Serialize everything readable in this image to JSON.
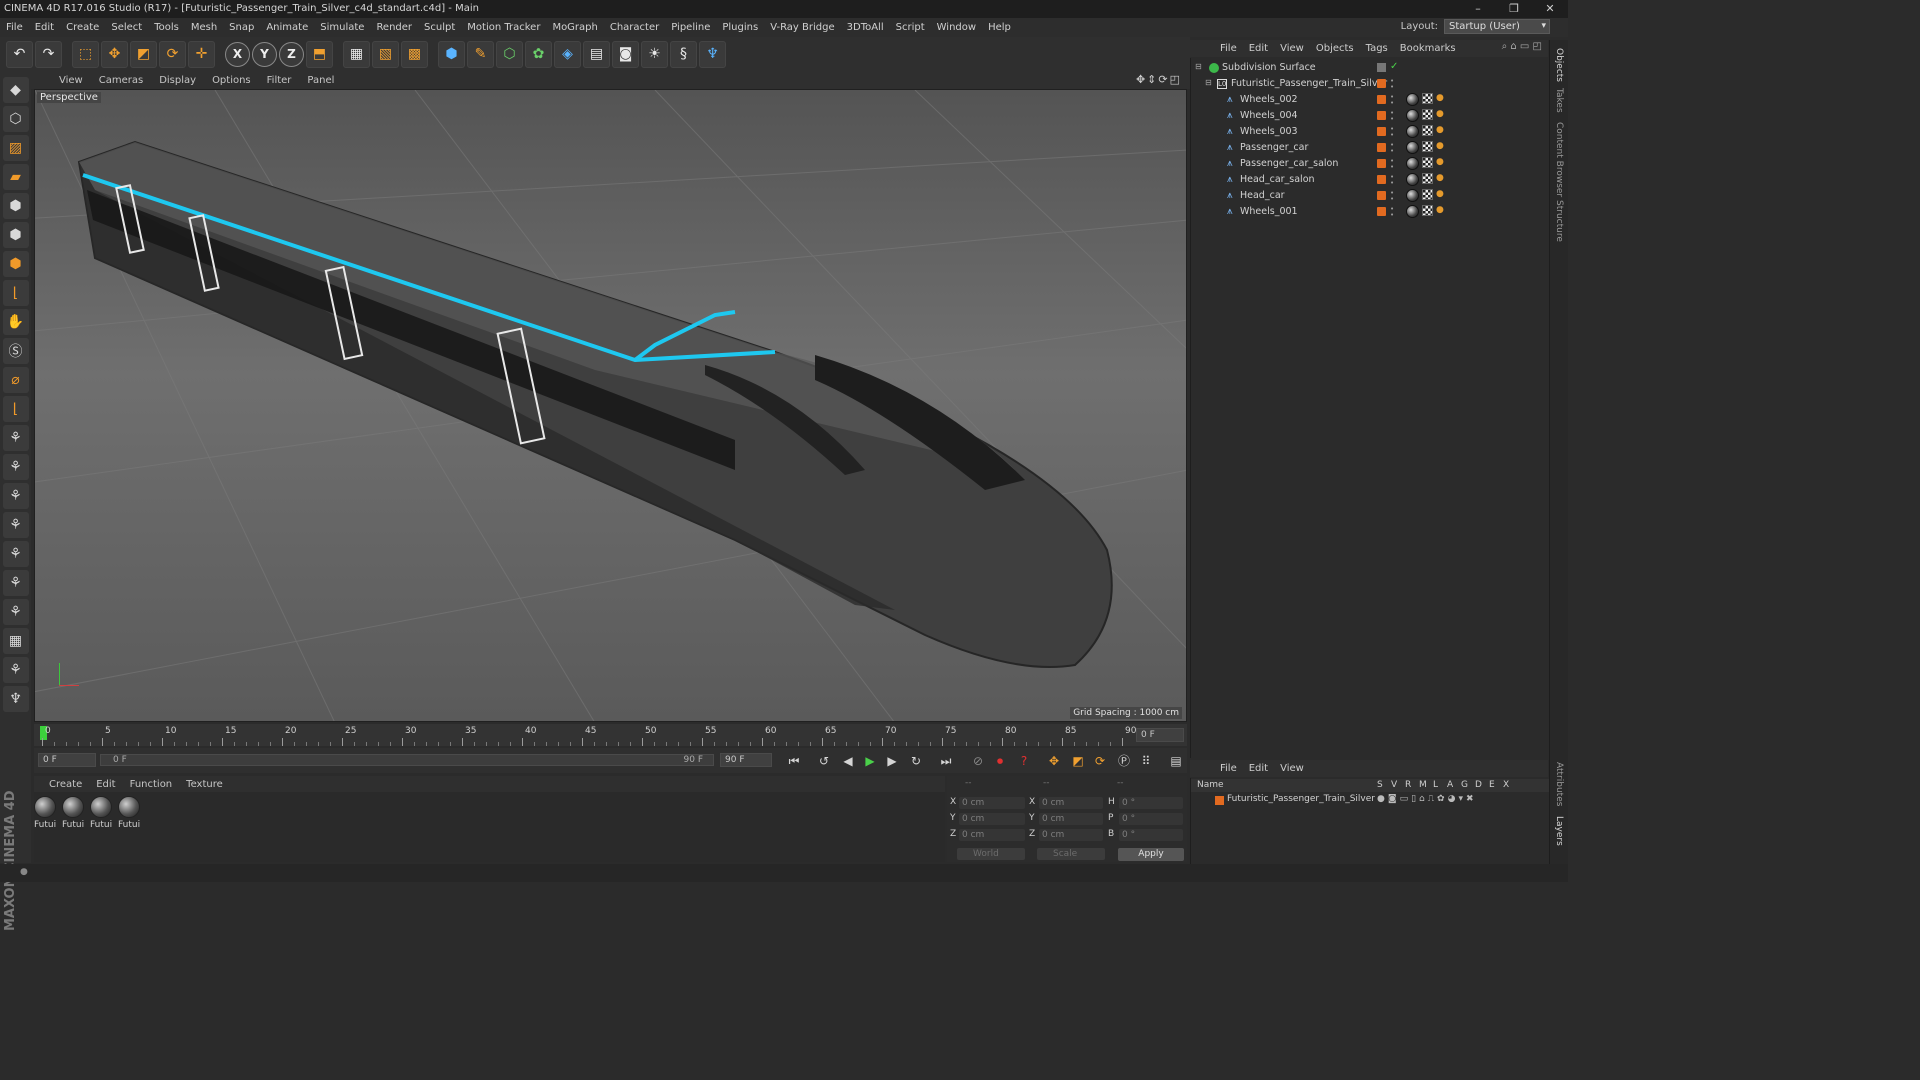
{
  "window": {
    "title": "CINEMA 4D R17.016 Studio (R17) - [Futuristic_Passenger_Train_Silver_c4d_standart.c4d] - Main",
    "minimize": "–",
    "restore": "❐",
    "close": "✕"
  },
  "menubar": {
    "items": [
      "File",
      "Edit",
      "Create",
      "Select",
      "Tools",
      "Mesh",
      "Snap",
      "Animate",
      "Simulate",
      "Render",
      "Sculpt",
      "Motion Tracker",
      "MoGraph",
      "Character",
      "Pipeline",
      "Plugins",
      "V-Ray Bridge",
      "3DToAll",
      "Script",
      "Window",
      "Help"
    ],
    "layout_label": "Layout:",
    "layout_value": "Startup (User)"
  },
  "viewport": {
    "menu": [
      "View",
      "Cameras",
      "Display",
      "Options",
      "Filter",
      "Panel"
    ],
    "label": "Perspective",
    "grid_spacing": "Grid Spacing : 1000 cm"
  },
  "timeline": {
    "ticks": [
      "0",
      "5",
      "10",
      "15",
      "20",
      "25",
      "30",
      "35",
      "40",
      "45",
      "50",
      "55",
      "60",
      "65",
      "70",
      "75",
      "80",
      "85",
      "90"
    ],
    "current_frame_display": "0 F",
    "start_frame": "0 F",
    "range_start": "0 F",
    "range_end": "90 F",
    "end_frame": "90 F"
  },
  "material_manager": {
    "menu": [
      "Create",
      "Edit",
      "Function",
      "Texture"
    ],
    "materials": [
      "Futui",
      "Futui",
      "Futui",
      "Futui"
    ]
  },
  "coordinates": {
    "header": [
      "--",
      "--",
      "--"
    ],
    "rows": [
      {
        "axis": "X",
        "pos": "0 cm",
        "axis2": "X",
        "size": "0 cm",
        "rot_label": "H",
        "rot": "0 °"
      },
      {
        "axis": "Y",
        "pos": "0 cm",
        "axis2": "Y",
        "size": "0 cm",
        "rot_label": "P",
        "rot": "0 °"
      },
      {
        "axis": "Z",
        "pos": "0 cm",
        "axis2": "Z",
        "size": "0 cm",
        "rot_label": "B",
        "rot": "0 °"
      }
    ],
    "mode1": "World",
    "mode2": "Scale",
    "apply": "Apply"
  },
  "object_manager": {
    "menu": [
      "File",
      "Edit",
      "View",
      "Objects",
      "Tags",
      "Bookmarks"
    ],
    "objects": [
      {
        "name": "Subdivision Surface",
        "level": 0
      },
      {
        "name": "Futuristic_Passenger_Train_Silver",
        "level": 1
      },
      {
        "name": "Wheels_002",
        "level": 2
      },
      {
        "name": "Wheels_004",
        "level": 2
      },
      {
        "name": "Wheels_003",
        "level": 2
      },
      {
        "name": "Passenger_car",
        "level": 2
      },
      {
        "name": "Passenger_car_salon",
        "level": 2
      },
      {
        "name": "Head_car_salon",
        "level": 2
      },
      {
        "name": "Head_car",
        "level": 2
      },
      {
        "name": "Wheels_001",
        "level": 2
      }
    ]
  },
  "layer_manager": {
    "menu": [
      "File",
      "Edit",
      "View"
    ],
    "columns": [
      "Name",
      "S",
      "V",
      "R",
      "M",
      "L",
      "A",
      "G",
      "D",
      "E",
      "X"
    ],
    "layer_name": "Futuristic_Passenger_Train_Silver"
  },
  "right_tabs": [
    "Objects",
    "Takes",
    "Content Browser",
    "Structure",
    "Attributes",
    "Layers"
  ],
  "logo": "MAXON CINEMA 4D",
  "colors": {
    "accent_cyan": "#1ec8f0",
    "layer_orange": "#e26a20",
    "ui_bg": "#2b2b2b"
  }
}
